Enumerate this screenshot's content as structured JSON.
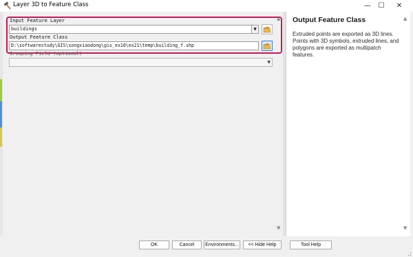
{
  "window": {
    "title": "Layer 3D to Feature Class",
    "minimize_glyph": "—",
    "maximize_glyph": "☐",
    "close_glyph": "✕",
    "app_icon": "hammer-icon"
  },
  "params": {
    "input_layer": {
      "label": "Input Feature Layer",
      "value": "buildings"
    },
    "output_class": {
      "label": "Output Feature Class",
      "value": "D:\\softwarestudy\\GIS\\songxiaodong\\gis_ex10\\ex21\\temp\\building_f.shp"
    },
    "grouping_field": {
      "label": "Grouping Field (optional)",
      "value": ""
    }
  },
  "help": {
    "title": "Output Feature Class",
    "body": "Extruded points are exported as 3D lines. Points with 3D symbols, extruded lines, and polygons are exported as multipatch features."
  },
  "buttons": {
    "ok": "OK",
    "cancel": "Cancel",
    "environments": "Environments...",
    "hide_help": "<< Hide Help",
    "tool_help": "Tool Help"
  },
  "colors": {
    "highlight": "#c2185b",
    "folder_yellow": "#e8b84a",
    "active_button_border": "#3a7bd5"
  }
}
